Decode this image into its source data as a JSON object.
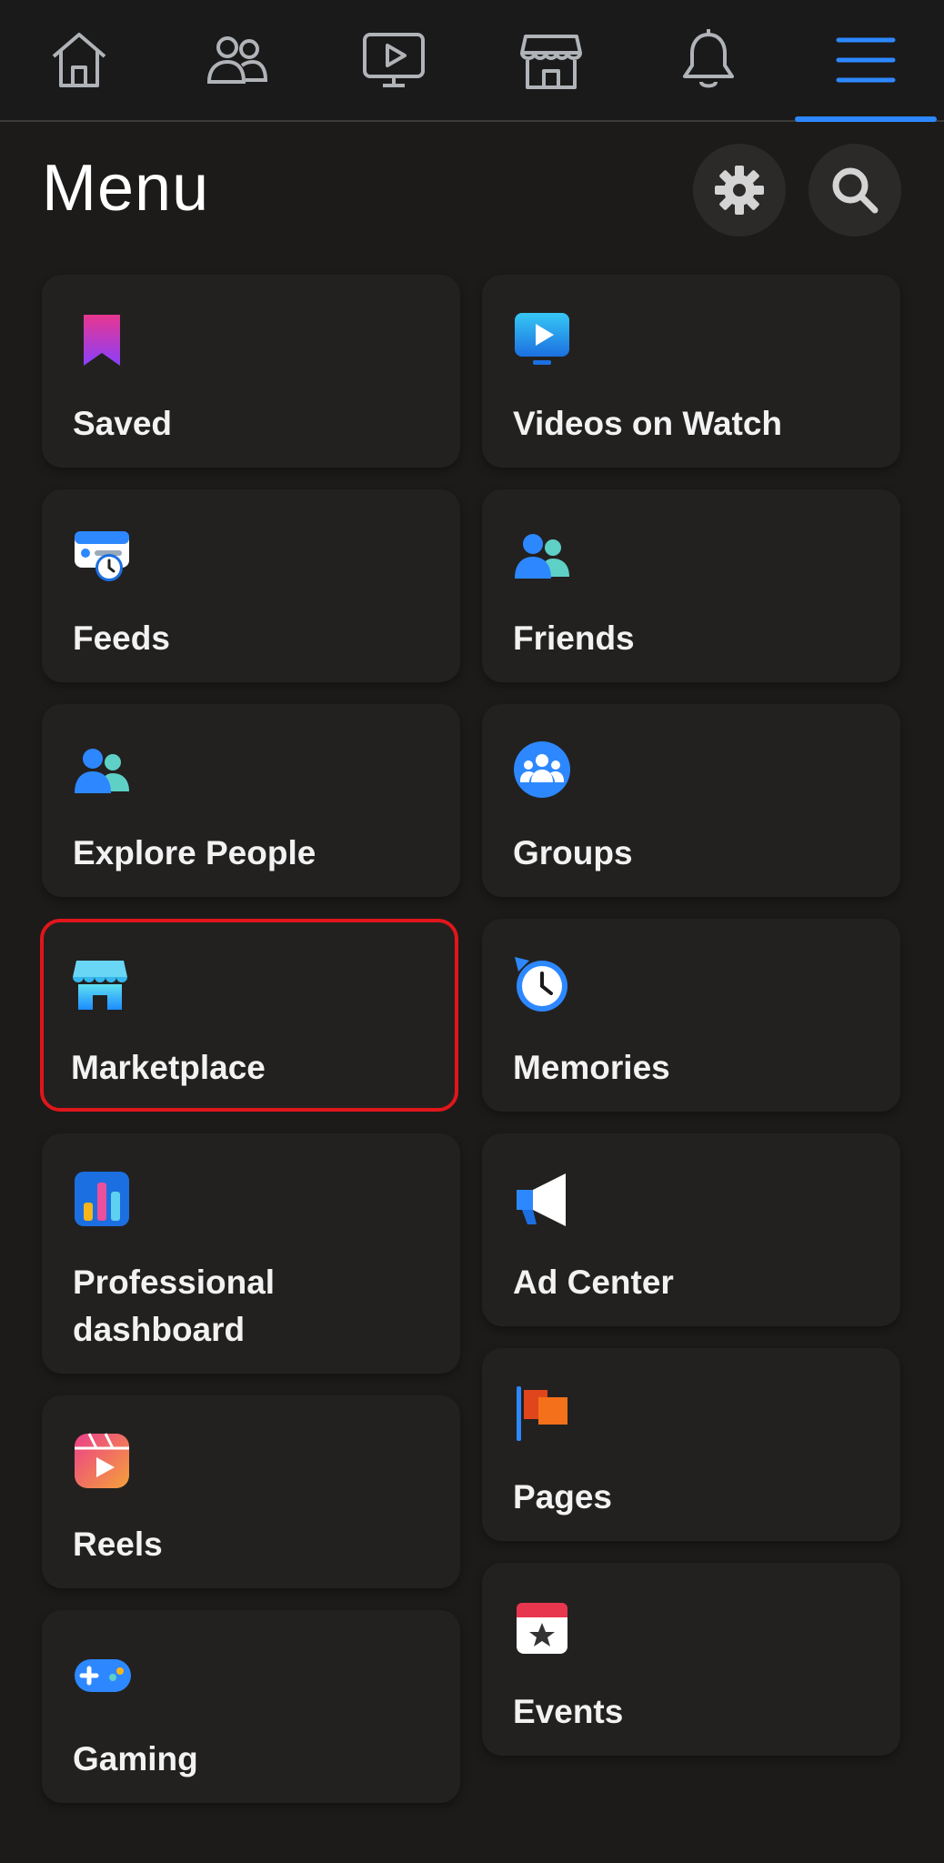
{
  "page_title": "Menu",
  "highlight_color": "#e0161b",
  "accent_color": "#2d88ff",
  "topnav": {
    "tabs": [
      {
        "icon": "home-icon"
      },
      {
        "icon": "friends-icon"
      },
      {
        "icon": "watch-icon"
      },
      {
        "icon": "marketplace-icon"
      },
      {
        "icon": "notifications-icon"
      },
      {
        "icon": "menu-icon",
        "active": true
      }
    ]
  },
  "header_buttons": {
    "settings_icon": "gear-icon",
    "search_icon": "search-icon"
  },
  "left_column": [
    {
      "label": "Saved",
      "icon": "bookmark-icon"
    },
    {
      "label": "Feeds",
      "icon": "feeds-icon"
    },
    {
      "label": "Explore People",
      "icon": "people-icon"
    },
    {
      "label": "Marketplace",
      "icon": "store-icon",
      "highlighted": true
    },
    {
      "label": "Professional dashboard",
      "icon": "bar-chart-icon"
    },
    {
      "label": "Reels",
      "icon": "reels-icon"
    },
    {
      "label": "Gaming",
      "icon": "game-controller-icon"
    }
  ],
  "right_column": [
    {
      "label": "Videos on Watch",
      "icon": "video-icon"
    },
    {
      "label": "Friends",
      "icon": "friends-icon"
    },
    {
      "label": "Groups",
      "icon": "groups-icon"
    },
    {
      "label": "Memories",
      "icon": "memories-clock-icon"
    },
    {
      "label": "Ad Center",
      "icon": "megaphone-icon"
    },
    {
      "label": "Pages",
      "icon": "flag-icon"
    },
    {
      "label": "Events",
      "icon": "calendar-icon"
    }
  ]
}
